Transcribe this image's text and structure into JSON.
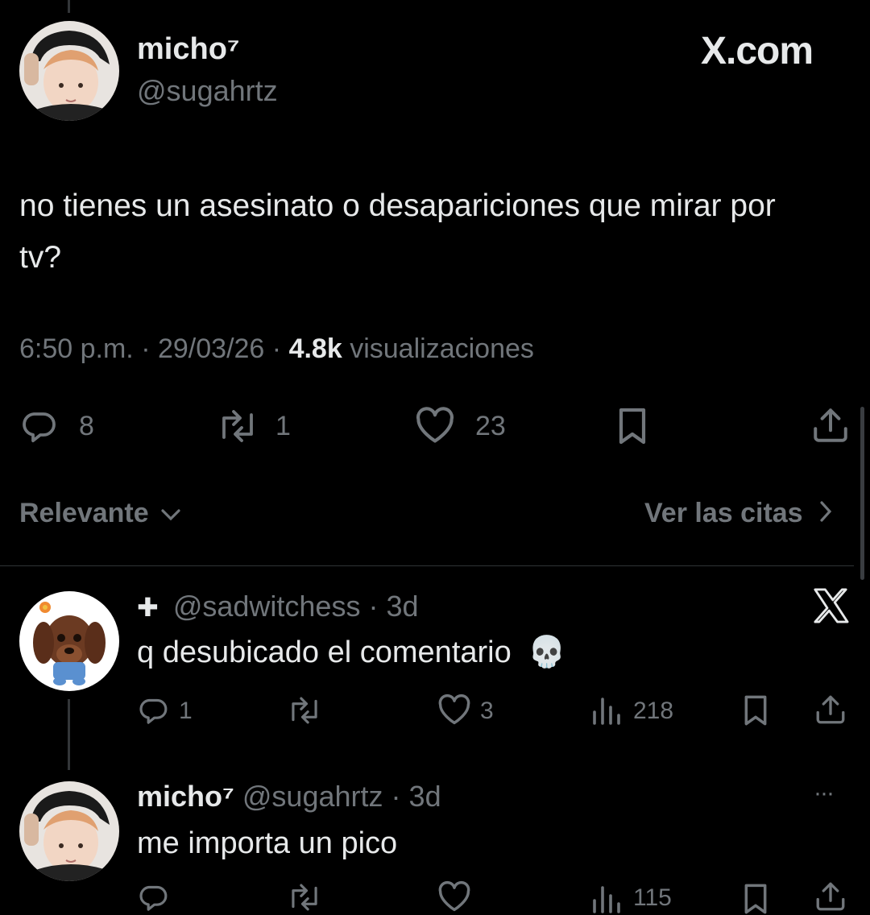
{
  "header": {
    "display_name": "micho⁷",
    "handle": "@sugahrtz",
    "site_label": "X.com"
  },
  "tweet": {
    "text": "no tienes un asesinato o desapariciones que mirar por tv?",
    "time": "6:50 p.m.",
    "sep1": "·",
    "date": "29/03/26",
    "sep2": "·",
    "views": "4.8k",
    "views_label": "visualizaciones",
    "replies": "8",
    "reposts": "1",
    "likes": "23"
  },
  "sort_bar": {
    "relevance_label": "Relevante",
    "quotes_label": "Ver las citas"
  },
  "replies": [
    {
      "prefix": "✚",
      "handle": "@sadwitchess",
      "dot": "·",
      "age": "3d",
      "text": "q desubicado el comentario",
      "emoji": "💀",
      "reply_count": "1",
      "like_count": "3",
      "view_count": "218"
    },
    {
      "display_name": "micho⁷",
      "handle": "@sugahrtz",
      "dot": "·",
      "age": "3d",
      "more": "···",
      "text": "me importa un pico",
      "view_count": "115"
    }
  ],
  "colors": {
    "background": "#000000",
    "text": "#e7e9ea",
    "secondary": "#71767b",
    "divider": "#2f3336"
  }
}
